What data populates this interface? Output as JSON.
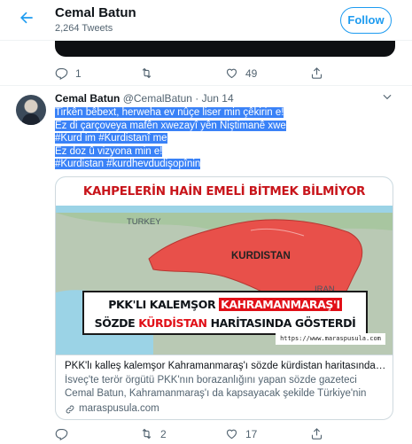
{
  "header": {
    "title": "Cemal Batun",
    "subtitle": "2,264 Tweets",
    "follow_label": "Follow"
  },
  "prev_tweet": {
    "actions": {
      "reply": "1",
      "retweet": "",
      "like": "49",
      "share": ""
    }
  },
  "tweet": {
    "name": "Cemal Batun",
    "handle_date": "@CemalBatun · Jun 14",
    "lines": [
      "Tirkên bêbext, herweha ev nûçe liser min çêkirin e!",
      "Ez di çarçoveya mafên xwezayî yên Niştimanê xwe",
      "#Kurd im #Kurdistanî me",
      "Ez doz û vizyona min e!",
      "#Kurdistan #kurdhevdudişopînin"
    ],
    "actions": {
      "reply": "",
      "retweet": "2",
      "like": "17",
      "share": ""
    }
  },
  "card": {
    "image": {
      "headline": "KAHPELERİN HAİN EMELİ BİTMEK BİLMİYOR",
      "label_turkey": "TURKEY",
      "label_kurdistan": "KURDISTAN",
      "label_iran": "IRAN",
      "banner_line1_a": "PKK'LI KALEMŞOR",
      "banner_line1_b": "KAHRAMANMARAŞ'I",
      "banner_line2_a": "SÖZDE",
      "banner_line2_b": "KÜRDİSTAN",
      "banner_line2_c": "HARİTASINDA GÖSTERDİ",
      "url": "https://www.maraspusula.com"
    },
    "title": "PKK'lı kalleş kalemşor Kahramanmaraş'ı sözde kürdistan haritasında gös...",
    "description": "İsveç'te terör örgütü PKK'nın borazanlığını yapan sözde gazeteci Cemal Batun, Kahramanmaraş'ı da kapsayacak şekilde Türkiye'nin birçok ilini ...",
    "domain": "maraspusula.com"
  },
  "colors": {
    "accent": "#1d9bf0",
    "selection": "#3a82f7",
    "headline_red": "#c8151b",
    "map_region": "#e8504a"
  }
}
